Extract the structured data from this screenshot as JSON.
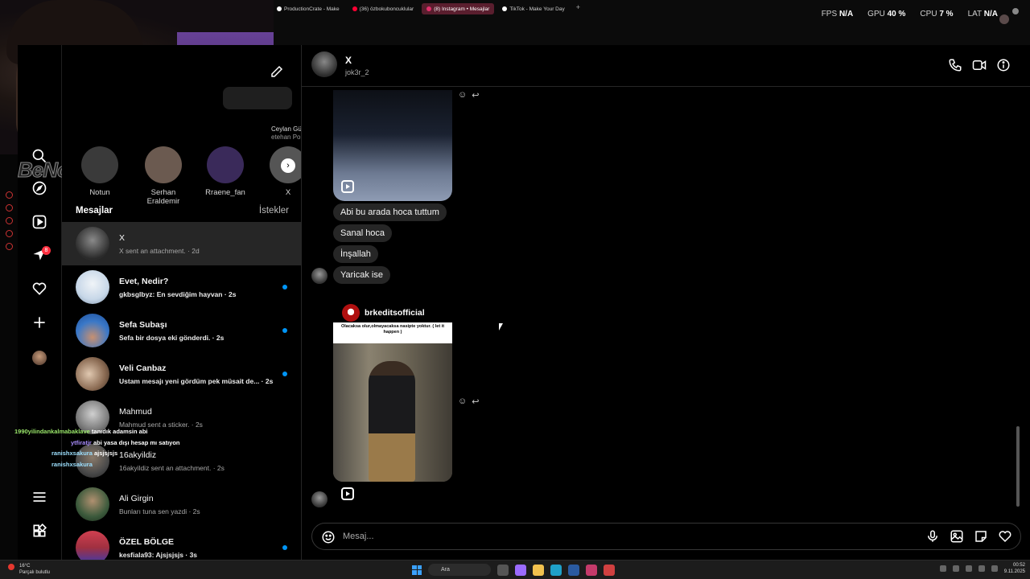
{
  "browser": {
    "tabs": [
      {
        "label": "ProductionCrate - Make",
        "icon": "productioncrate-icon",
        "color": "#ffffff",
        "active": false
      },
      {
        "label": "(36) özbokuboncuklular",
        "icon": "youtube-icon",
        "color": "#ff0033",
        "active": false
      },
      {
        "label": "(8) Instagram • Mesajlar",
        "icon": "instagram-icon",
        "color": "#e1306c",
        "active": true
      },
      {
        "label": "TikTok - Make Your Day",
        "icon": "tiktok-icon",
        "color": "#ffffff",
        "active": false
      }
    ],
    "new_tab": "+"
  },
  "stats": {
    "fps_label": "FPS",
    "fps_value": "N/A",
    "gpu_label": "GPU",
    "gpu_value": "40 %",
    "cpu_label": "CPU",
    "cpu_value": "7 %",
    "lat_label": "LAT",
    "lat_value": "N/A"
  },
  "overlay_logo": "BeNoGame",
  "nav": {
    "icons": [
      "search-icon",
      "explore-icon",
      "reels-icon",
      "messenger-icon",
      "heart-icon",
      "create-icon",
      "profile-avatar",
      "menu-icon",
      "more-apps-icon"
    ],
    "messages_badge": "8"
  },
  "notes": [
    {
      "name": "Notun",
      "color": "#3a3a3a"
    },
    {
      "name": "Serhan Eraldemir",
      "color": "#6b5a50"
    },
    {
      "name": "Rraene_fan",
      "color": "#3a2a5a"
    },
    {
      "name": "X",
      "color": "#555555"
    }
  ],
  "note_bubble": {
    "title": "Ceylan Gü",
    "subtitle": "etehan Po"
  },
  "inbox": {
    "title": "Mesajlar",
    "requests": "İstekler",
    "threads": [
      {
        "name": "X",
        "preview": "X sent an attachment. · 2d",
        "unread": false,
        "active": true,
        "avatar_color": "#5a5a5a"
      },
      {
        "name": "Evet, Nedir?",
        "preview": "gkbsglbyz: En sevdiğim hayvan · 2s",
        "unread": true,
        "active": false,
        "avatar_color": "#c7d7e8"
      },
      {
        "name": "Sefa Subaşı",
        "preview": "Sefa bir dosya eki gönderdi. · 2s",
        "unread": true,
        "active": false,
        "avatar_color": "#3a78c8"
      },
      {
        "name": "Veli Canbaz",
        "preview": "Ustam mesajı yeni gördüm pek müsait de... · 2s",
        "unread": true,
        "active": false,
        "avatar_color": "#8a6a52"
      },
      {
        "name": "Mahmud",
        "preview": "Mahmud sent a sticker. · 2s",
        "unread": false,
        "active": false,
        "avatar_color": "#7a7a7a"
      },
      {
        "name": "16akyildiz",
        "preview": "16akyildiz sent an attachment. · 2s",
        "unread": false,
        "active": false,
        "avatar_color": "#4a4a4a"
      },
      {
        "name": "Ali Girgin",
        "preview": "Bunları tuna sen yazdi · 2s",
        "unread": false,
        "active": false,
        "avatar_color": "#3c5a3c"
      },
      {
        "name": "ÖZEL BÖLGE",
        "preview": "kesfiala93: Ajsjsjsjs · 3s",
        "unread": true,
        "active": false,
        "avatar_color": "#a03040"
      }
    ]
  },
  "stream_chat": [
    {
      "user": "1990yilindankalmabaklave",
      "message": "tanıdık adamsin abi"
    },
    {
      "user": "ytfiratjr",
      "message": "abi yasa dışı hesap mı satıyon"
    },
    {
      "user": "ranishxsakura",
      "message": "ajsjsjsjs"
    },
    {
      "user": "ranishxsakura",
      "message": ""
    }
  ],
  "conversation": {
    "name": "X",
    "username": "jok3r_2",
    "header_icons": [
      "phone-icon",
      "video-icon",
      "info-icon"
    ],
    "messages": [
      "Abi bu arada hoca tuttum",
      "Sanal hoca",
      "İnşallah",
      "Yaricak ise"
    ],
    "shared_post": {
      "account": "brkeditsofficial",
      "caption": "Olacaksa olur,olmayacaksa nasipte yoktur. ( let it happen )"
    },
    "composer_placeholder": "Mesaj...",
    "composer_icons": [
      "microphone-icon",
      "image-icon",
      "sticker-icon",
      "heart-icon"
    ]
  },
  "taskbar": {
    "weather_temp": "16°C",
    "weather_desc": "Parçalı bulutlu",
    "search": "Ara",
    "time": "00:52",
    "date": "9.11.2025"
  }
}
